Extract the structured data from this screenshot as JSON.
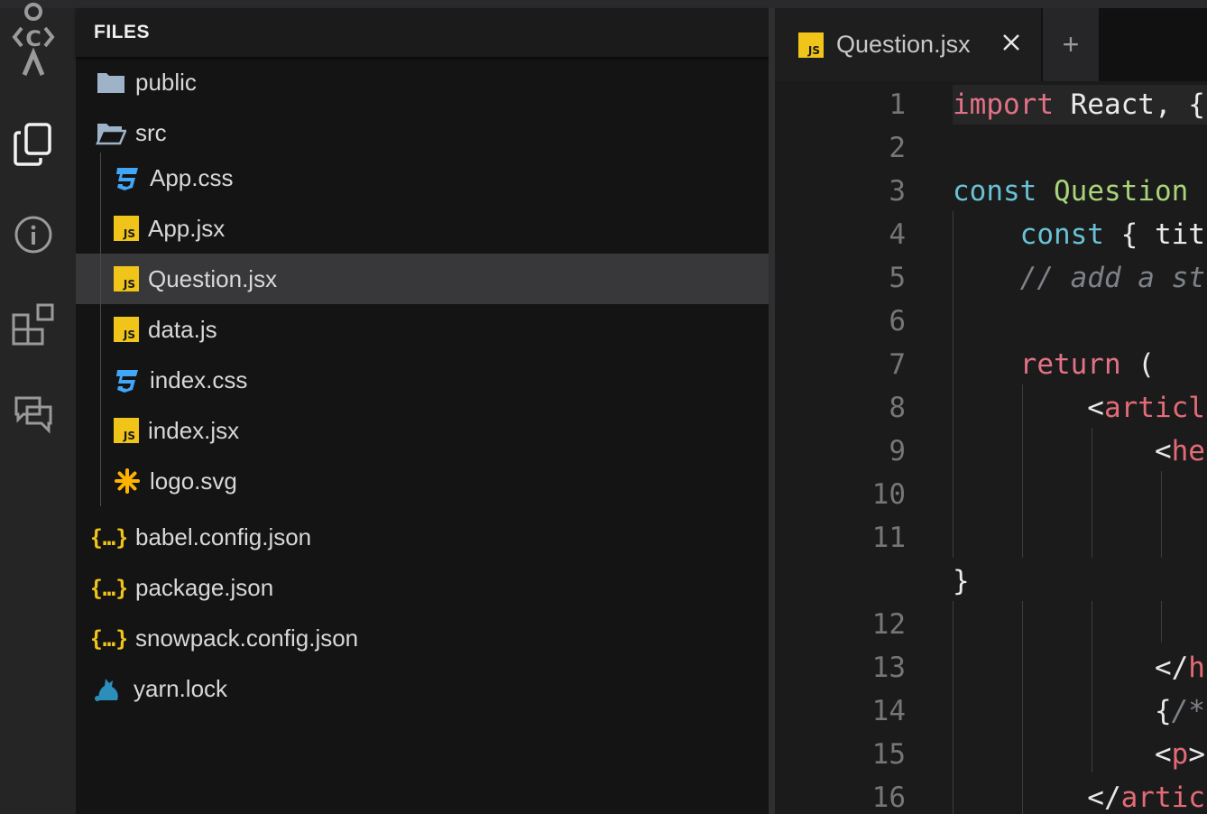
{
  "sidebar": {
    "title": "FILES",
    "items": [
      {
        "label": "public",
        "icon": "folder-icon",
        "depth": 0
      },
      {
        "label": "src",
        "icon": "folder-open-icon",
        "depth": 0
      },
      {
        "label": "App.css",
        "icon": "css-file-icon",
        "depth": 1
      },
      {
        "label": "App.jsx",
        "icon": "js-file-icon",
        "depth": 1
      },
      {
        "label": "Question.jsx",
        "icon": "js-file-icon",
        "depth": 1,
        "active": true
      },
      {
        "label": "data.js",
        "icon": "js-file-icon",
        "depth": 1
      },
      {
        "label": "index.css",
        "icon": "css-file-icon",
        "depth": 1
      },
      {
        "label": "index.jsx",
        "icon": "js-file-icon",
        "depth": 1
      },
      {
        "label": "logo.svg",
        "icon": "svg-file-icon",
        "depth": 1
      },
      {
        "label": "babel.config.json",
        "icon": "json-file-icon",
        "depth": 0
      },
      {
        "label": "package.json",
        "icon": "json-file-icon",
        "depth": 0
      },
      {
        "label": "snowpack.config.json",
        "icon": "json-file-icon",
        "depth": 0
      },
      {
        "label": "yarn.lock",
        "icon": "yarn-file-icon",
        "depth": 0
      }
    ]
  },
  "activity_bar": {
    "icons": [
      "codesandbox-logo-icon",
      "files-icon",
      "info-icon",
      "extensions-icon",
      "comments-icon"
    ]
  },
  "editor": {
    "tab": {
      "label": "Question.jsx",
      "icon": "js-file-icon"
    },
    "new_tab": "+",
    "lines": [
      {
        "n": "1",
        "tokens": [
          {
            "t": "import",
            "c": "kw"
          },
          {
            "t": " React, {",
            "c": "tx"
          }
        ]
      },
      {
        "n": "2",
        "tokens": []
      },
      {
        "n": "3",
        "tokens": [
          {
            "t": "const",
            "c": "cst"
          },
          {
            "t": " ",
            "c": "tx"
          },
          {
            "t": "Question",
            "c": "fn"
          }
        ]
      },
      {
        "n": "4",
        "tokens": [
          {
            "t": "    ",
            "c": "tx"
          },
          {
            "t": "const",
            "c": "cst"
          },
          {
            "t": " { tit",
            "c": "tx"
          }
        ]
      },
      {
        "n": "5",
        "tokens": [
          {
            "t": "    ",
            "c": "tx"
          },
          {
            "t": "// add a st",
            "c": "cm"
          }
        ]
      },
      {
        "n": "6",
        "tokens": []
      },
      {
        "n": "7",
        "tokens": [
          {
            "t": "    ",
            "c": "tx"
          },
          {
            "t": "return",
            "c": "kw"
          },
          {
            "t": " (",
            "c": "tx"
          }
        ]
      },
      {
        "n": "8",
        "tokens": [
          {
            "t": "        <",
            "c": "pl"
          },
          {
            "t": "articl",
            "c": "tg"
          }
        ]
      },
      {
        "n": "9",
        "tokens": [
          {
            "t": "            <",
            "c": "pl"
          },
          {
            "t": "he",
            "c": "tg"
          }
        ]
      },
      {
        "n": "10",
        "tokens": []
      },
      {
        "n": "11",
        "tokens": []
      },
      {
        "n": "",
        "tokens": [
          {
            "t": "}",
            "c": "tx"
          }
        ]
      },
      {
        "n": "12",
        "tokens": []
      },
      {
        "n": "13",
        "tokens": [
          {
            "t": "            </",
            "c": "pl"
          },
          {
            "t": "h",
            "c": "tg"
          }
        ]
      },
      {
        "n": "14",
        "tokens": [
          {
            "t": "            {",
            "c": "pl"
          },
          {
            "t": "/*",
            "c": "cm"
          }
        ]
      },
      {
        "n": "15",
        "tokens": [
          {
            "t": "            <",
            "c": "pl"
          },
          {
            "t": "p",
            "c": "tg"
          },
          {
            "t": ">",
            "c": "pl"
          }
        ]
      },
      {
        "n": "16",
        "tokens": [
          {
            "t": "        </",
            "c": "pl"
          },
          {
            "t": "artic",
            "c": "tg"
          }
        ]
      }
    ]
  },
  "colors": {
    "accent_js": "#f0c419",
    "accent_css": "#42a5f5",
    "accent_svg": "#ffb300",
    "keyword": "#e27285",
    "constant": "#68c1d4",
    "function": "#a8d47a"
  }
}
